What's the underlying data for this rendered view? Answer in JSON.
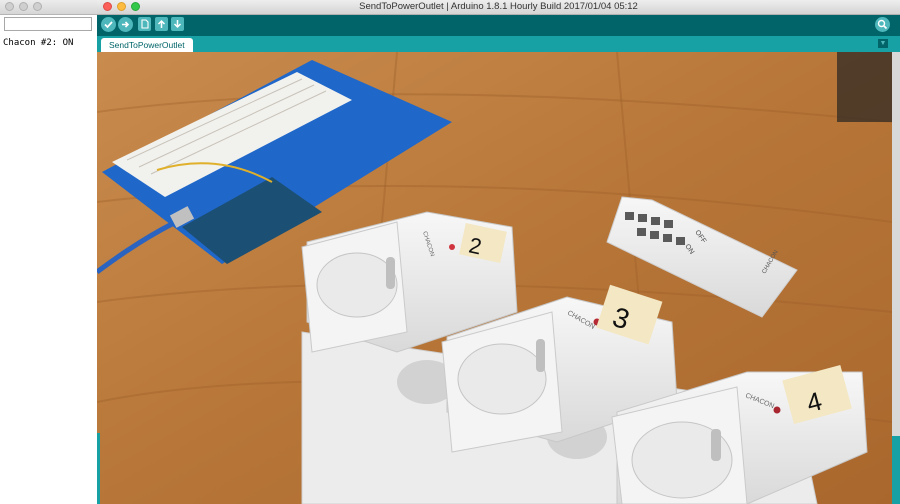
{
  "serial_monitor": {
    "send_input": "",
    "output_lines": [
      "Chacon #2: ON"
    ]
  },
  "ide": {
    "window_title": "SendToPowerOutlet | Arduino 1.8.1 Hourly Build 2017/01/04 05:12",
    "toolbar": {
      "verify_icon": "check-icon",
      "upload_icon": "arrow-right-icon",
      "new_icon": "new-file-icon",
      "open_icon": "arrow-up-icon",
      "save_icon": "arrow-down-icon",
      "serial_monitor_icon": "magnifier-icon"
    },
    "tabs": [
      "SendToPowerOutlet"
    ],
    "colors": {
      "toolbar": "#006468",
      "tabbar": "#17a1a5",
      "button": "#4db7bb"
    }
  },
  "photo": {
    "plugs": [
      {
        "label": "2",
        "brand": "CHACON"
      },
      {
        "label": "3",
        "brand": "CHACON"
      },
      {
        "label": "4",
        "brand": "CHACON"
      }
    ],
    "remote": {
      "brand": "CHACON",
      "side_labels": [
        "ON",
        "OFF"
      ]
    }
  }
}
